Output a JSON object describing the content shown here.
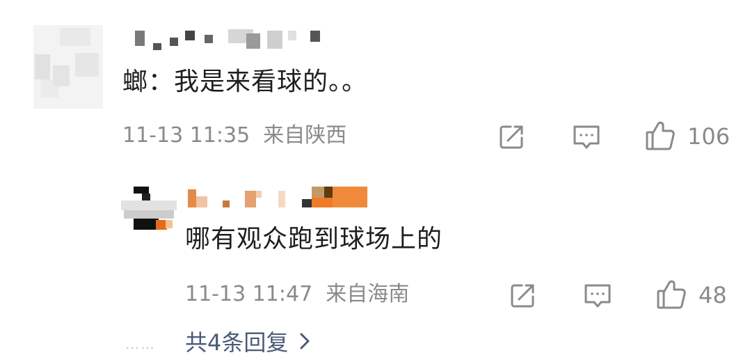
{
  "main_comment": {
    "text": "螂：我是来看球的。。",
    "time": "11-13 11:35",
    "location": "来自陕西",
    "likes": "106",
    "icons": {
      "share": "share-icon",
      "comment": "comment-icon",
      "like": "thumbs-up-icon"
    }
  },
  "reply": {
    "text": "哪有观众跑到球场上的",
    "time": "11-13 11:47",
    "location": "来自海南",
    "likes": "48",
    "icons": {
      "share": "share-icon",
      "comment": "comment-icon",
      "like": "thumbs-up-icon"
    }
  },
  "replies_link": {
    "dots": "……",
    "label": "共4条回复",
    "chevron": "chevron-right-icon"
  },
  "colors": {
    "meta_gray": "#8a8a8a",
    "link_blue_gray": "#4a5a78",
    "text_dark": "#1e1e1e"
  }
}
